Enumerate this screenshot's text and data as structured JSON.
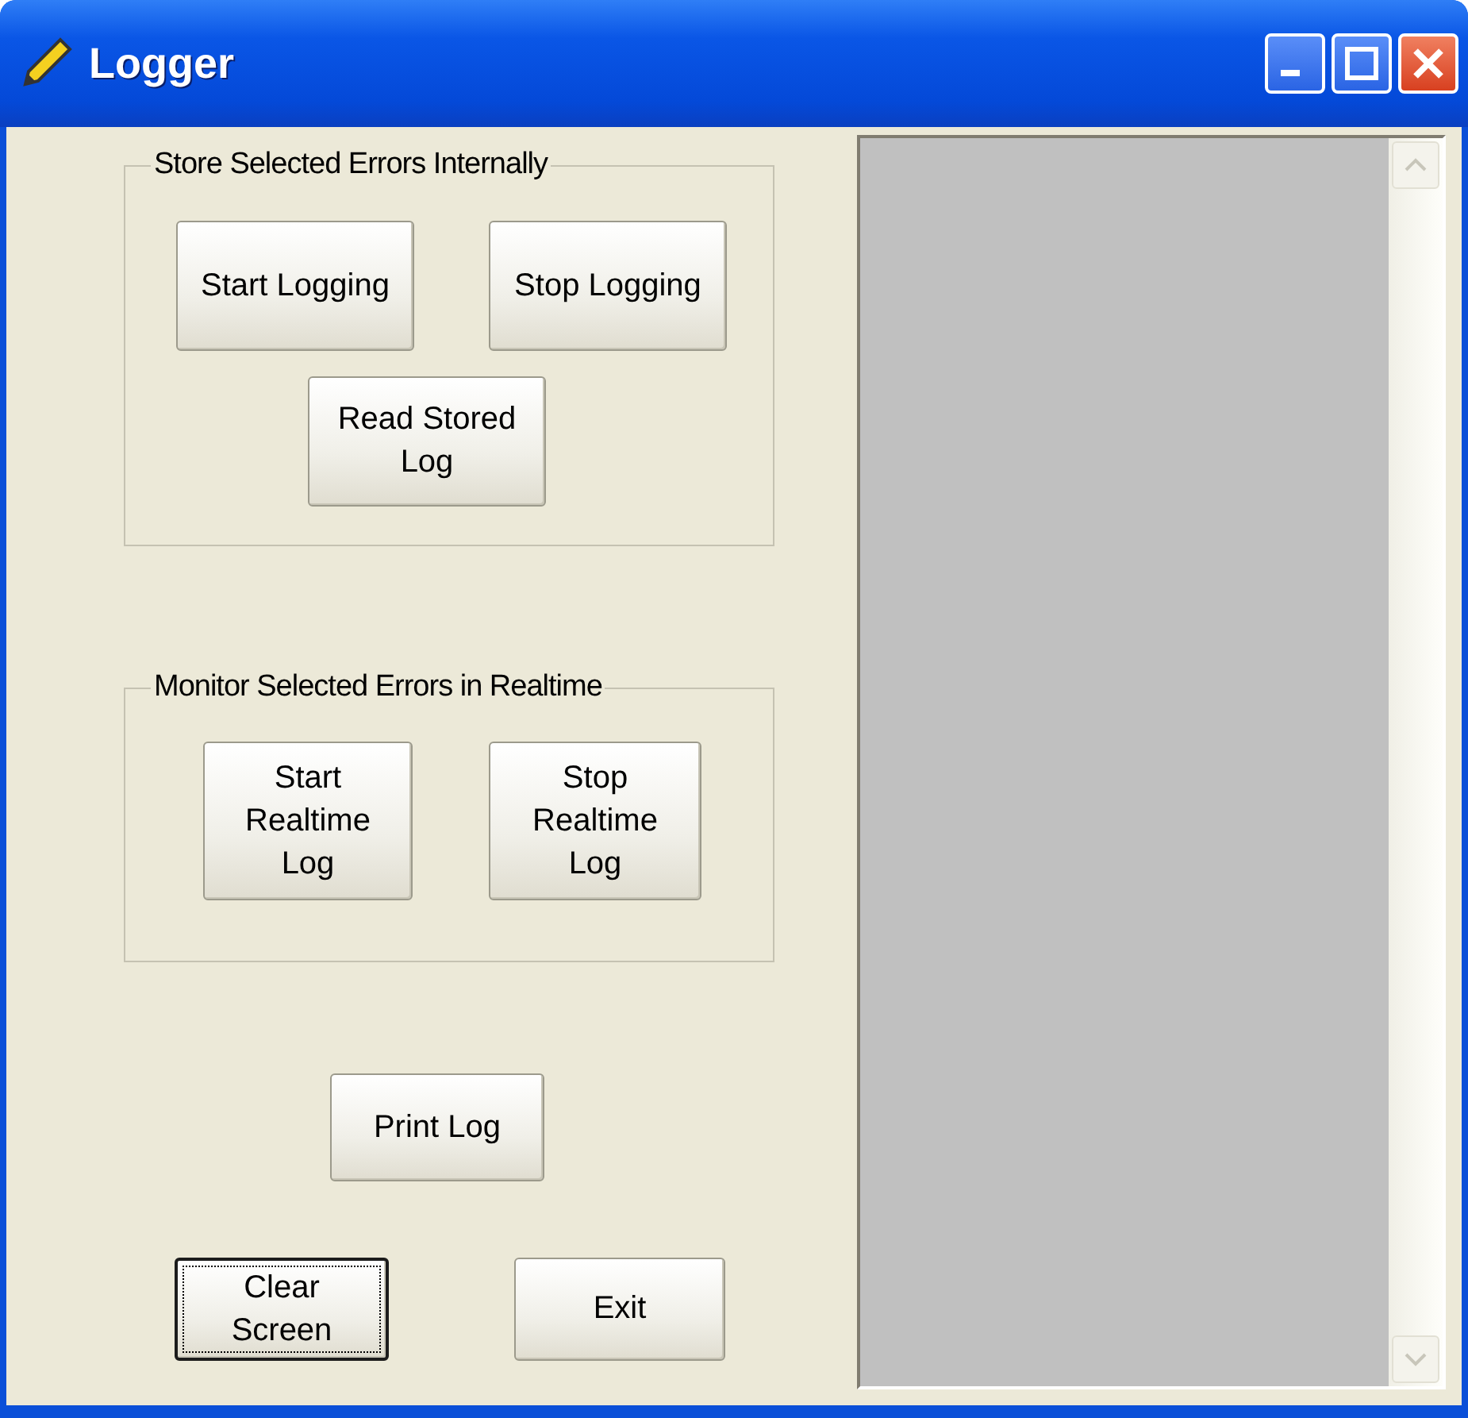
{
  "window": {
    "title": "Logger"
  },
  "groups": [
    {
      "title": "Store Selected Errors Internally",
      "buttons": [
        {
          "label": "Start Logging",
          "focused": false
        },
        {
          "label": "Stop Logging",
          "focused": false
        },
        {
          "label": "Read Stored Log",
          "focused": false
        }
      ]
    },
    {
      "title": "Monitor Selected Errors in Realtime",
      "buttons": [
        {
          "label": "Start Realtime Log",
          "focused": false
        },
        {
          "label": "Stop Realtime Log",
          "focused": false
        }
      ]
    }
  ],
  "print_button": {
    "label": "Print Log",
    "focused": false
  },
  "bottom_buttons": [
    {
      "label": "Clear Screen",
      "focused": true
    },
    {
      "label": "Exit",
      "focused": false
    }
  ]
}
